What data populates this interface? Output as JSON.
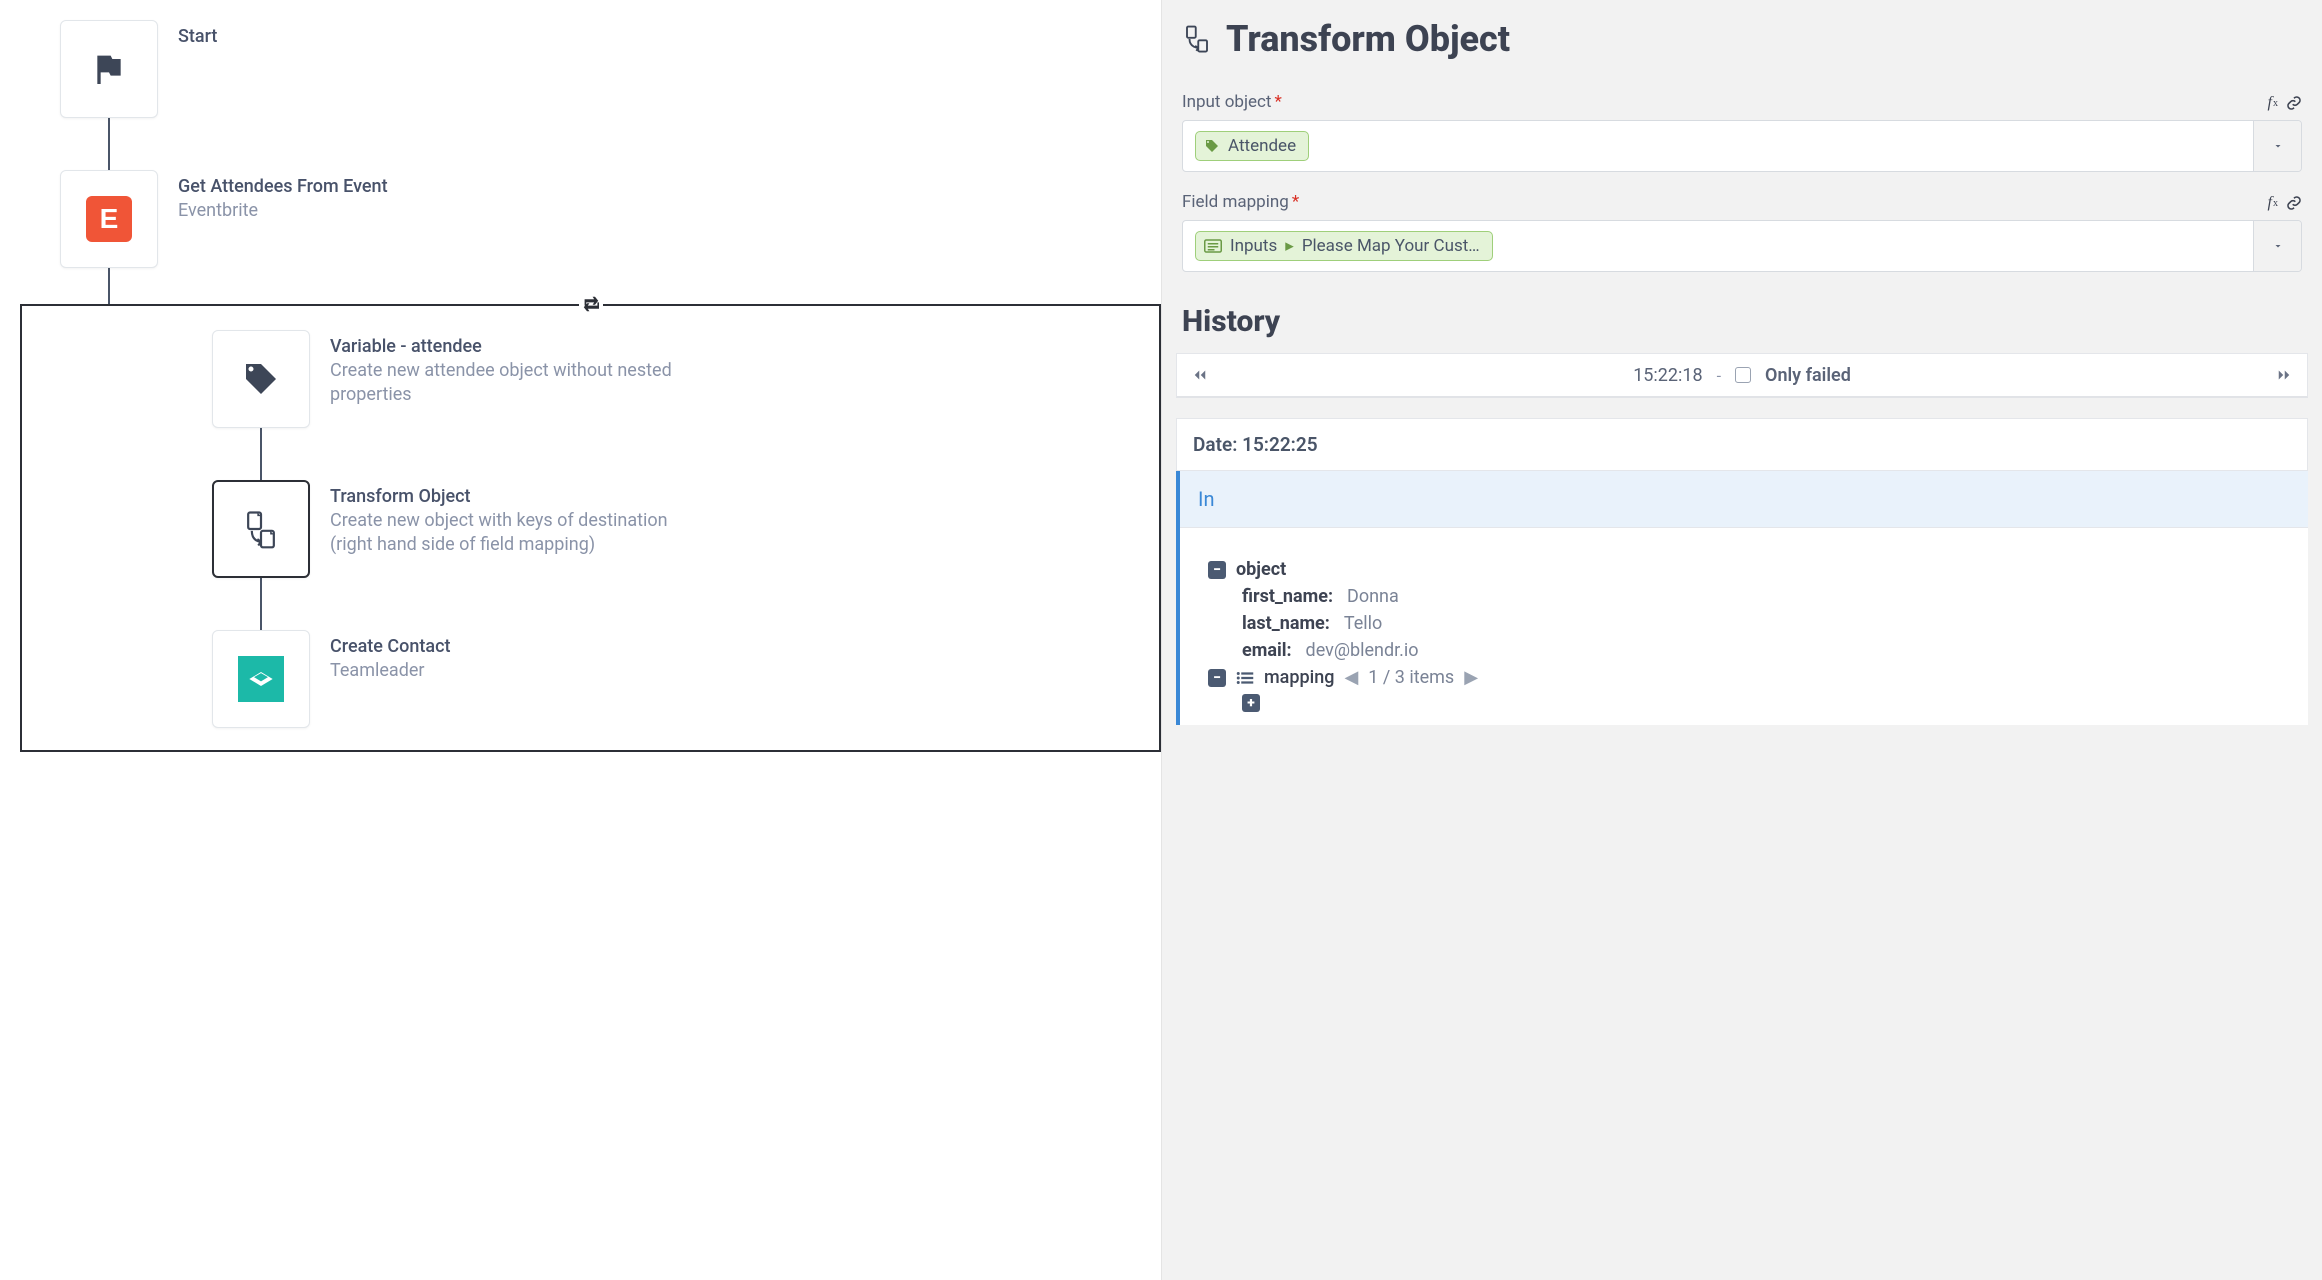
{
  "flow": {
    "start": {
      "title": "Start"
    },
    "get_attendees": {
      "title": "Get Attendees From Event",
      "subtitle": "Eventbrite"
    },
    "variable": {
      "title": "Variable - attendee",
      "subtitle": "Create new attendee object without nested properties"
    },
    "transform": {
      "title": "Transform Object",
      "subtitle": "Create new object with keys of destination (right hand side of field mapping)"
    },
    "create_contact": {
      "title": "Create Contact",
      "subtitle": "Teamleader"
    }
  },
  "panel": {
    "title": "Transform Object",
    "input_object": {
      "label": "Input object",
      "chip": "Attendee"
    },
    "field_mapping": {
      "label": "Field mapping",
      "chip_prefix": "Inputs",
      "chip_text": "Please Map Your Cust…"
    },
    "history": {
      "heading": "History",
      "time": "15:22:18",
      "dash": "-",
      "only_failed": "Only failed",
      "date_label": "Date: 15:22:25",
      "in_label": "In",
      "object_label": "object",
      "fields": {
        "first_name": {
          "key": "first_name:",
          "val": "Donna"
        },
        "last_name": {
          "key": "last_name:",
          "val": "Tello"
        },
        "email": {
          "key": "email:",
          "val": "dev@blendr.io"
        }
      },
      "mapping_label": "mapping",
      "pager": "1 / 3 items"
    }
  }
}
